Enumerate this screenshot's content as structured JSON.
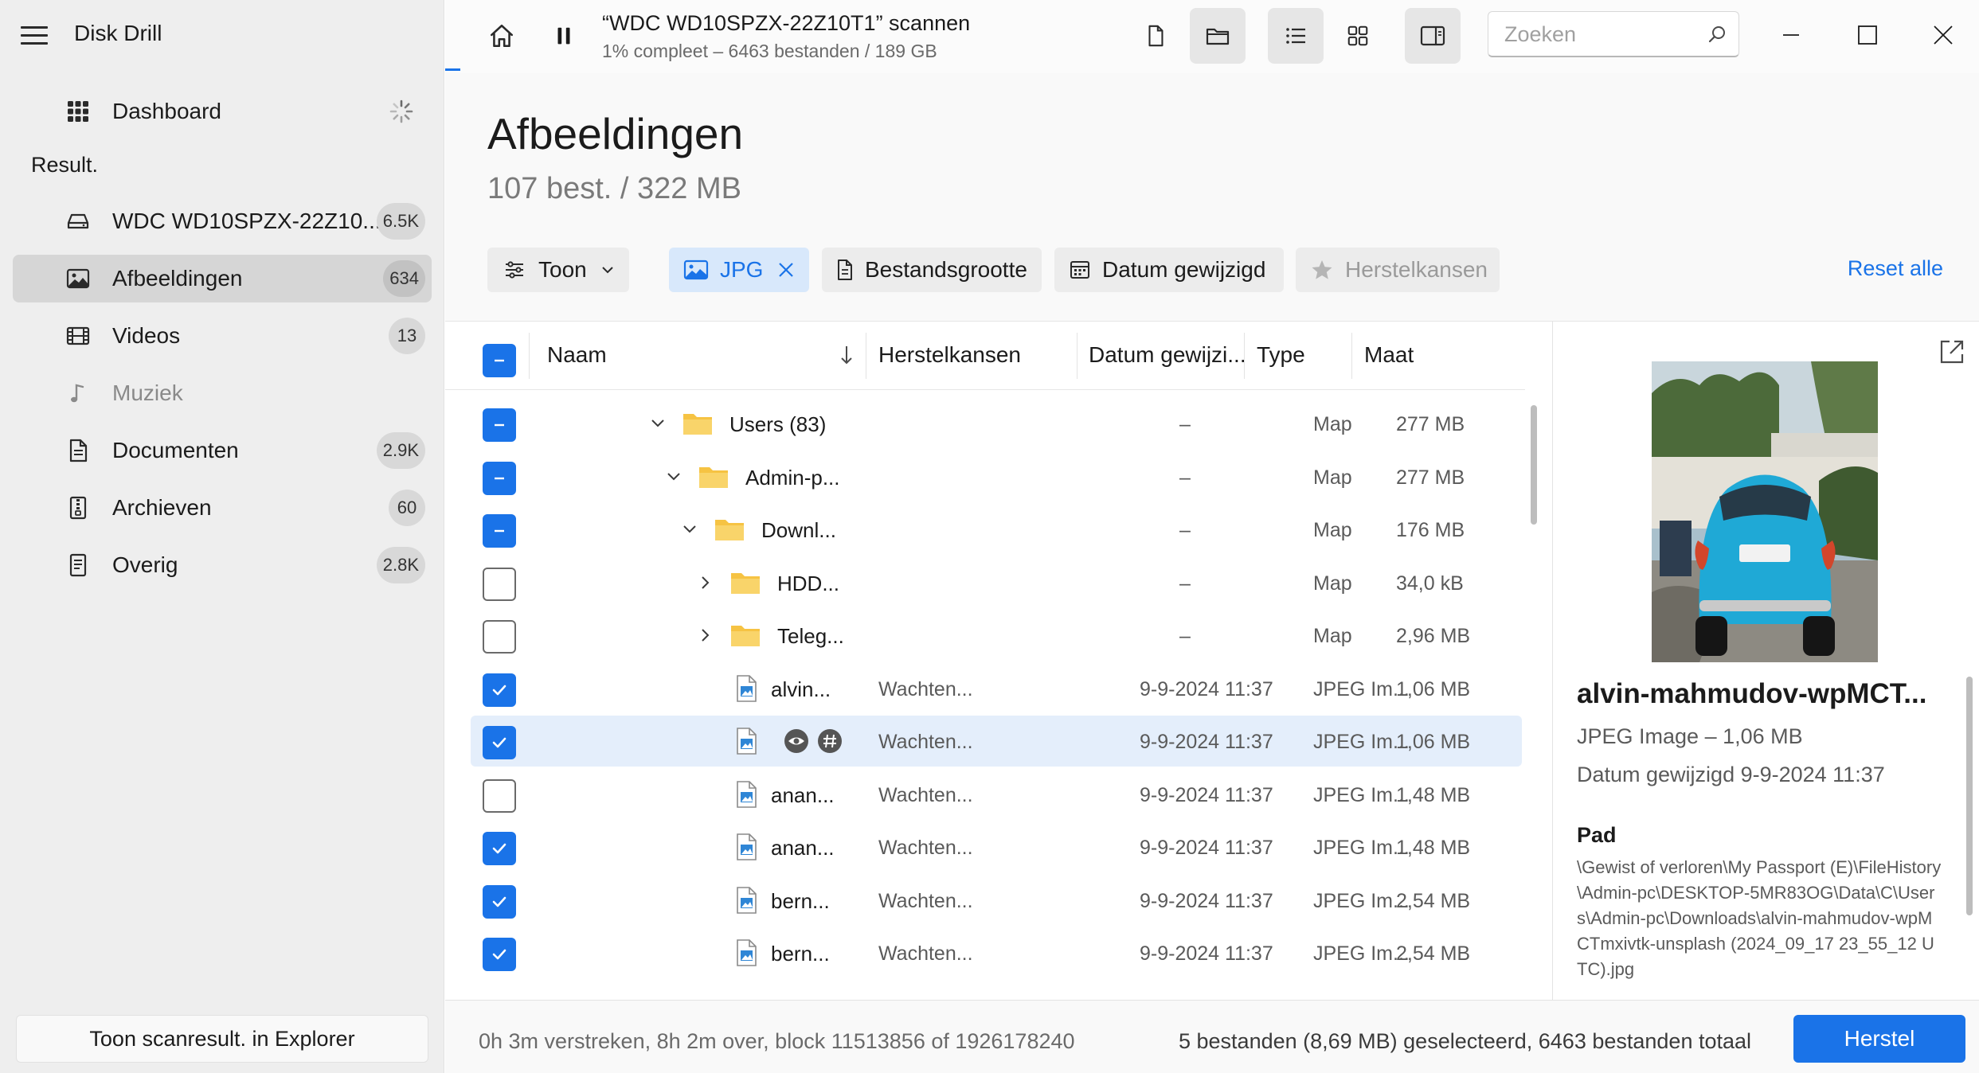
{
  "app": {
    "title": "Disk Drill"
  },
  "sidebar": {
    "dashboard": {
      "label": "Dashboard"
    },
    "section_label": "Result.",
    "items": [
      {
        "label": "WDC WD10SPZX-22Z10...",
        "count": "6.5K",
        "icon": "drive-icon"
      },
      {
        "label": "Afbeeldingen",
        "count": "634",
        "icon": "image-icon"
      },
      {
        "label": "Videos",
        "count": "13",
        "icon": "film-icon"
      },
      {
        "label": "Muziek",
        "count": "",
        "icon": "music-note-icon"
      },
      {
        "label": "Documenten",
        "count": "2.9K",
        "icon": "document-icon"
      },
      {
        "label": "Archieven",
        "count": "60",
        "icon": "archive-icon"
      },
      {
        "label": "Overig",
        "count": "2.8K",
        "icon": "other-file-icon"
      }
    ],
    "bottom_button": "Toon scanresult. in Explorer"
  },
  "header": {
    "scan_title": "“WDC WD10SPZX-22Z10T1” scannen",
    "scan_subtitle": "1% compleet – 6463 bestanden / 189 GB",
    "scan_progress": 0.01,
    "search_placeholder": "Zoeken"
  },
  "main": {
    "title": "Afbeeldingen",
    "subtitle": "107 best. / 322 MB",
    "filters": {
      "show": "Toon",
      "jpg": "JPG",
      "size": "Bestandsgrootte",
      "date": "Datum gewijzigd",
      "chances": "Herstelkansen"
    },
    "reset_all": "Reset alle"
  },
  "table": {
    "columns": {
      "name": "Naam",
      "chances": "Herstelkansen",
      "date": "Datum gewijzi...",
      "type": "Type",
      "size": "Maat"
    },
    "rows": [
      {
        "name": "Users (83)",
        "chances": "",
        "date": "–",
        "type": "Map",
        "size": "277 MB",
        "state": "mixed",
        "kind": "folder",
        "expanded": true
      },
      {
        "name": "Admin-p...",
        "chances": "",
        "date": "–",
        "type": "Map",
        "size": "277 MB",
        "state": "mixed",
        "kind": "folder",
        "expanded": true
      },
      {
        "name": "Downl...",
        "chances": "",
        "date": "–",
        "type": "Map",
        "size": "176 MB",
        "state": "mixed",
        "kind": "folder",
        "expanded": true
      },
      {
        "name": "HDD...",
        "chances": "",
        "date": "–",
        "type": "Map",
        "size": "34,0 kB",
        "state": "unchecked",
        "kind": "folder",
        "expanded": false
      },
      {
        "name": "Teleg...",
        "chances": "",
        "date": "–",
        "type": "Map",
        "size": "2,96 MB",
        "state": "unchecked",
        "kind": "folder",
        "expanded": false
      },
      {
        "name": "alvin...",
        "chances": "Wachten...",
        "date": "9-9-2024 11:37",
        "type": "JPEG Im...",
        "size": "1,06 MB",
        "state": "checked",
        "kind": "image"
      },
      {
        "name": "",
        "chances": "Wachten...",
        "date": "9-9-2024 11:37",
        "type": "JPEG Im...",
        "size": "1,06 MB",
        "state": "checked",
        "kind": "image",
        "selected": true
      },
      {
        "name": "anan...",
        "chances": "Wachten...",
        "date": "9-9-2024 11:37",
        "type": "JPEG Im...",
        "size": "1,48 MB",
        "state": "unchecked",
        "kind": "image"
      },
      {
        "name": "anan...",
        "chances": "Wachten...",
        "date": "9-9-2024 11:37",
        "type": "JPEG Im...",
        "size": "1,48 MB",
        "state": "checked",
        "kind": "image"
      },
      {
        "name": "bern...",
        "chances": "Wachten...",
        "date": "9-9-2024 11:37",
        "type": "JPEG Im...",
        "size": "2,54 MB",
        "state": "checked",
        "kind": "image"
      },
      {
        "name": "bern...",
        "chances": "Wachten...",
        "date": "9-9-2024 11:37",
        "type": "JPEG Im...",
        "size": "2,54 MB",
        "state": "checked",
        "kind": "image"
      }
    ]
  },
  "preview": {
    "file_name": "alvin-mahmudov-wpMCT...",
    "type_size": "JPEG Image – 1,06 MB",
    "modified": "Datum gewijzigd 9-9-2024 11:37",
    "path_label": "Pad",
    "path": "\\Gewist of verloren\\My Passport (E)\\FileHistory\\Admin-pc\\DESKTOP-5MR83OG\\Data\\C\\Users\\Admin-pc\\Downloads\\alvin-mahmudov-wpMCTmxivtk-unsplash (2024_09_17 23_55_12 UTC).jpg"
  },
  "status": {
    "left": "0h 3m verstreken, 8h 2m over, block 11513856 of 1926178240",
    "right": "5 bestanden (8,69 MB) geselecteerd, 6463 bestanden totaal",
    "recover_button": "Herstel"
  },
  "colors": {
    "accent": "#1a73e8",
    "sidebar_bg": "#eeeeee",
    "selected_row": "#e4eefb",
    "folder": "#f6c343"
  }
}
